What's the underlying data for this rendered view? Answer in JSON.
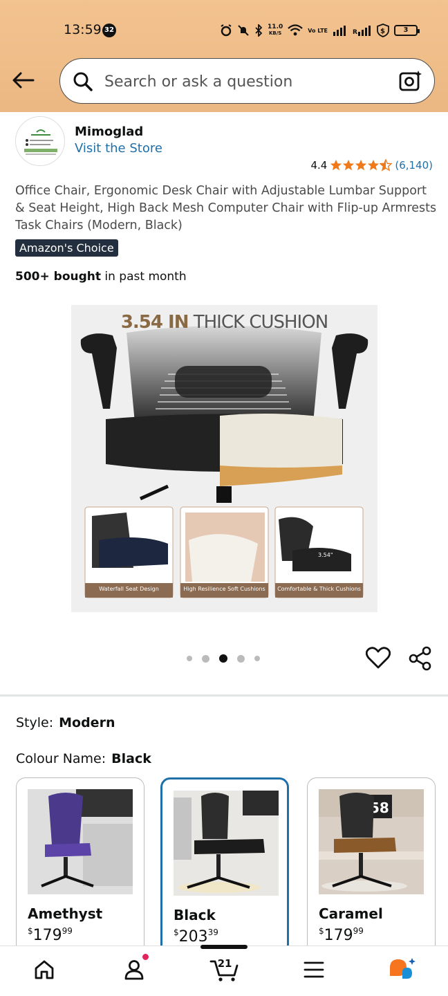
{
  "status_bar": {
    "time": "13:59",
    "notification_count": "32",
    "net_speed_value": "11.0",
    "net_speed_unit": "KB/S",
    "network_type": "Vo LTE",
    "battery": "3"
  },
  "header": {
    "search_placeholder": "Search or ask a question",
    "icons": [
      "back-arrow-icon",
      "search-icon",
      "camera-search-icon"
    ]
  },
  "store": {
    "name": "Mimoglad",
    "link": "Visit the Store"
  },
  "rating": {
    "value": "4.4",
    "stars": 4.4,
    "count": "(6,140)",
    "star_color": "#f0791a"
  },
  "product": {
    "title": "Office Chair, Ergonomic Desk Chair with Adjustable Lumbar Support & Seat Height, High Back Mesh Computer Chair with Flip-up Armrests Task Chairs (Modern, Black)",
    "badge": "Amazon's Choice",
    "bought_bold": "500+ bought",
    "bought_rest": " in past month"
  },
  "image": {
    "caption_bold": "3.54 IN",
    "caption_rest": " THICK CUSHION",
    "panels": [
      "Waterfall Seat Design",
      "High Resilience Soft Cushions",
      "Comfortable & Thick Cushions"
    ],
    "dimension_label": "3.54\"",
    "carousel_total": 5,
    "carousel_active": 3
  },
  "options": {
    "style_label": "Style:",
    "style_value": "Modern",
    "colour_label": "Colour Name:",
    "colour_value": "Black"
  },
  "swatches": [
    {
      "name": "Amethyst",
      "currency": "$",
      "whole": "179",
      "fraction": "99",
      "selected": false
    },
    {
      "name": "Black",
      "currency": "$",
      "whole": "203",
      "fraction": "39",
      "selected": true
    },
    {
      "name": "Caramel",
      "currency": "$",
      "whole": "179",
      "fraction": "99",
      "selected": false
    }
  ],
  "swatch_decor": {
    "clock_text": "58",
    "clock_prefix": ".2"
  },
  "bottom_nav": {
    "cart_count": "21",
    "items": [
      "home-icon",
      "account-icon",
      "cart-icon",
      "menu-icon",
      "rufus-assistant-icon"
    ]
  },
  "colors": {
    "header_bg": "#efbd88",
    "link_blue": "#1f6fa8",
    "badge_bg": "#232f3e",
    "selected_border": "#1f6fa8"
  }
}
